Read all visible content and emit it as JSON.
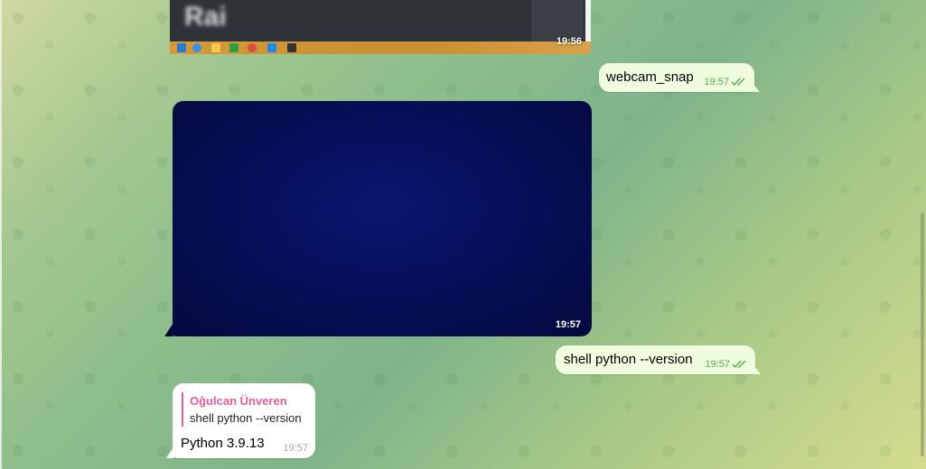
{
  "screenshot_message": {
    "blurred_text": "Rai",
    "time": "19:56"
  },
  "messages": {
    "webcam": {
      "text": "webcam_snap",
      "time": "19:57"
    },
    "media": {
      "time": "19:57"
    },
    "shell": {
      "text": "shell python --version",
      "time": "19:57"
    },
    "reply": {
      "quoted_sender": "Oğulcan Ünveren",
      "quoted_text": "shell python --version",
      "text": "Python 3.9.13",
      "time": "19:57"
    }
  },
  "colors": {
    "outgoing_bubble": "#effdde",
    "read_check": "#4fae4e",
    "reply_accent": "#e35e9d"
  },
  "icons": [
    "windows-start-icon",
    "ie-icon",
    "file-explorer-icon",
    "store-icon",
    "chrome-icon",
    "vscode-icon",
    "terminal-icon",
    "double-check-icon"
  ]
}
